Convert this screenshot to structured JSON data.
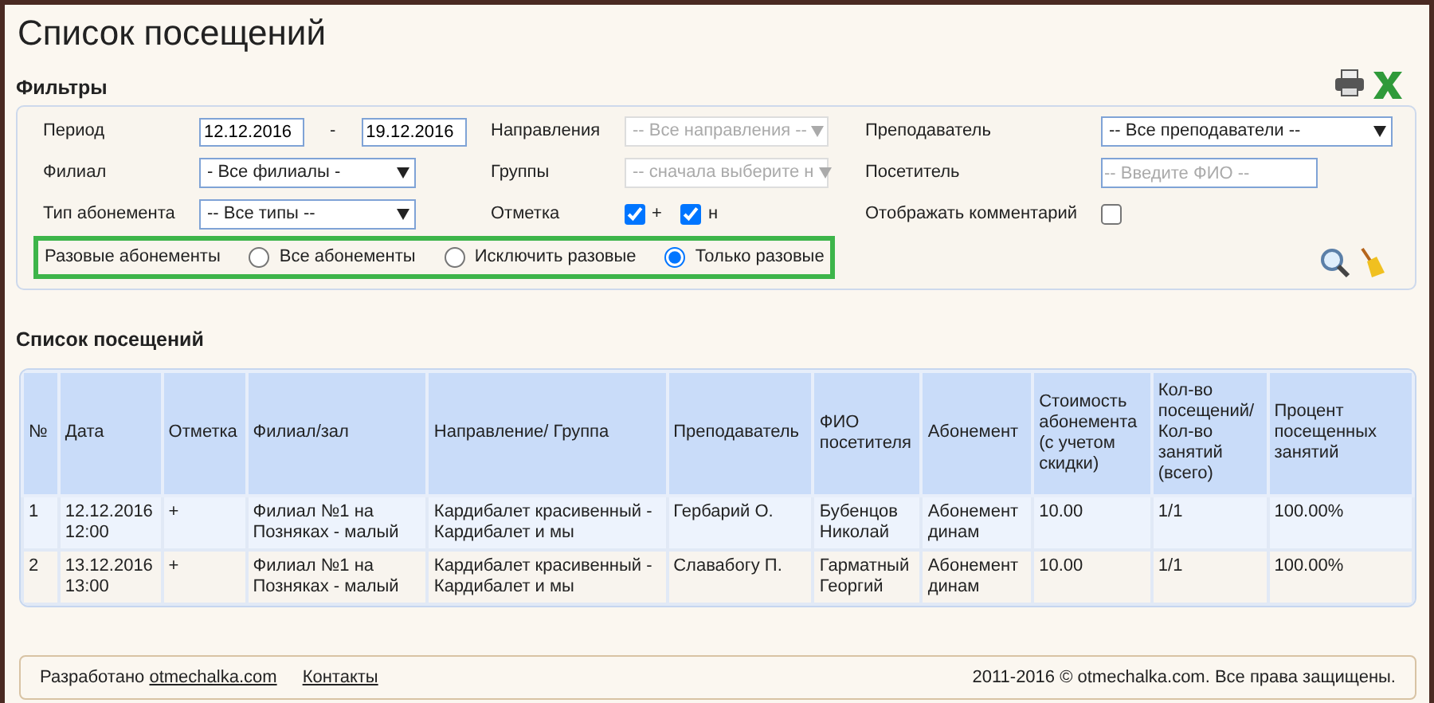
{
  "title": "Список посещений",
  "filters": {
    "heading": "Фильтры",
    "fields": [
      {
        "kind": "date_range",
        "label": "Период",
        "from": "12.12.2016",
        "separator": "-",
        "to": "19.12.2016"
      },
      {
        "kind": "select",
        "label": "Направления",
        "value": "-- Все направления --",
        "disabled": true
      },
      {
        "kind": "select",
        "label": "Преподаватель",
        "value": "-- Все преподаватели --",
        "disabled": false
      },
      {
        "kind": "select",
        "label": "Филиал",
        "value": "- Все филиалы -",
        "disabled": false
      },
      {
        "kind": "select",
        "label": "Группы",
        "value": "-- сначала выберите н",
        "disabled": true
      },
      {
        "kind": "text",
        "label": "Посетитель",
        "placeholder": "-- Введите ФИО --"
      },
      {
        "kind": "select",
        "label": "Тип абонемента",
        "value": "-- Все типы --",
        "disabled": false
      },
      {
        "kind": "checks",
        "label": "Отметка",
        "items": [
          {
            "label": "+",
            "checked": true
          },
          {
            "label": "н",
            "checked": true
          }
        ]
      },
      {
        "kind": "checkbox",
        "label": "Отображать комментарий",
        "checked": false
      }
    ],
    "one_time": {
      "label": "Разовые абонементы",
      "options": [
        {
          "label": "Все абонементы",
          "selected": false
        },
        {
          "label": "Исключить разовые",
          "selected": false
        },
        {
          "label": "Только разовые",
          "selected": true
        }
      ]
    }
  },
  "list": {
    "heading": "Список посещений",
    "columns": [
      "№",
      "Дата",
      "Отметка",
      "Филиал/зал",
      "Направление/ Группа",
      "Преподаватель",
      "ФИО посетителя",
      "Абонемент",
      "Стоимость абонемента (с учетом скидки)",
      "Кол-во посещений/ Кол-во занятий (всего)",
      "Процент посещенных занятий"
    ],
    "rows": [
      [
        "1",
        "12.12.2016 12:00",
        "+",
        "Филиал №1 на Позняках - малый",
        "Кардибалет красивенный - Кардибалет и мы",
        "Гербарий О.",
        "Бубенцов Николай",
        "Абонемент динам",
        "10.00",
        "1/1",
        "100.00%"
      ],
      [
        "2",
        "13.12.2016 13:00",
        "+",
        "Филиал №1 на Позняках - малый",
        "Кардибалет красивенный - Кардибалет и мы",
        "Славабогу П.",
        "Гарматный Георгий",
        "Абонемент динам",
        "10.00",
        "1/1",
        "100.00%"
      ]
    ]
  },
  "footer": {
    "developed_by": "Разработано",
    "site_link": "otmechalka.com",
    "contacts_link": "Контакты",
    "copyright": "2011-2016 © otmechalka.com. Все права защищены."
  }
}
